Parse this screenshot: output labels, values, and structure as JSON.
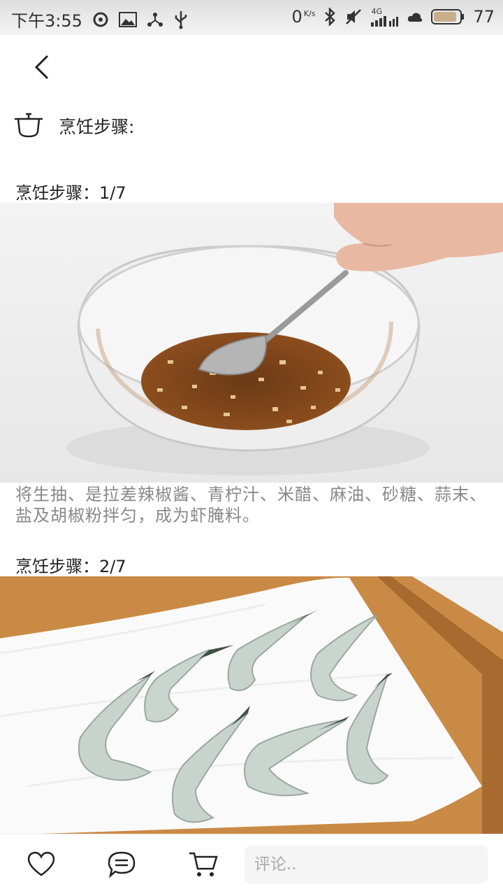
{
  "status_bar": {
    "time": "下午3:55",
    "network_speed": "0",
    "speed_unit": "K/s",
    "network_type": "4G",
    "battery": "77"
  },
  "section": {
    "title": "烹饪步骤:"
  },
  "steps": [
    {
      "label": "烹饪步骤：1/7",
      "description": "将生抽、是拉差辣椒酱、青柠汁、米醋、麻油、砂糖、蒜末、盐及胡椒粉拌匀，成为虾腌料。",
      "photo": "glass bowl with sauce and spoon"
    },
    {
      "label": "烹饪步骤：2/7",
      "photo": "raw shrimp on paper towel"
    }
  ],
  "bottom_bar": {
    "comment_placeholder": "评论.."
  },
  "icons": {
    "back": "chevron-left-icon",
    "pot": "cooking-pot-icon",
    "like": "heart-icon",
    "comment": "chat-bubble-icon",
    "cart": "shopping-cart-icon"
  }
}
